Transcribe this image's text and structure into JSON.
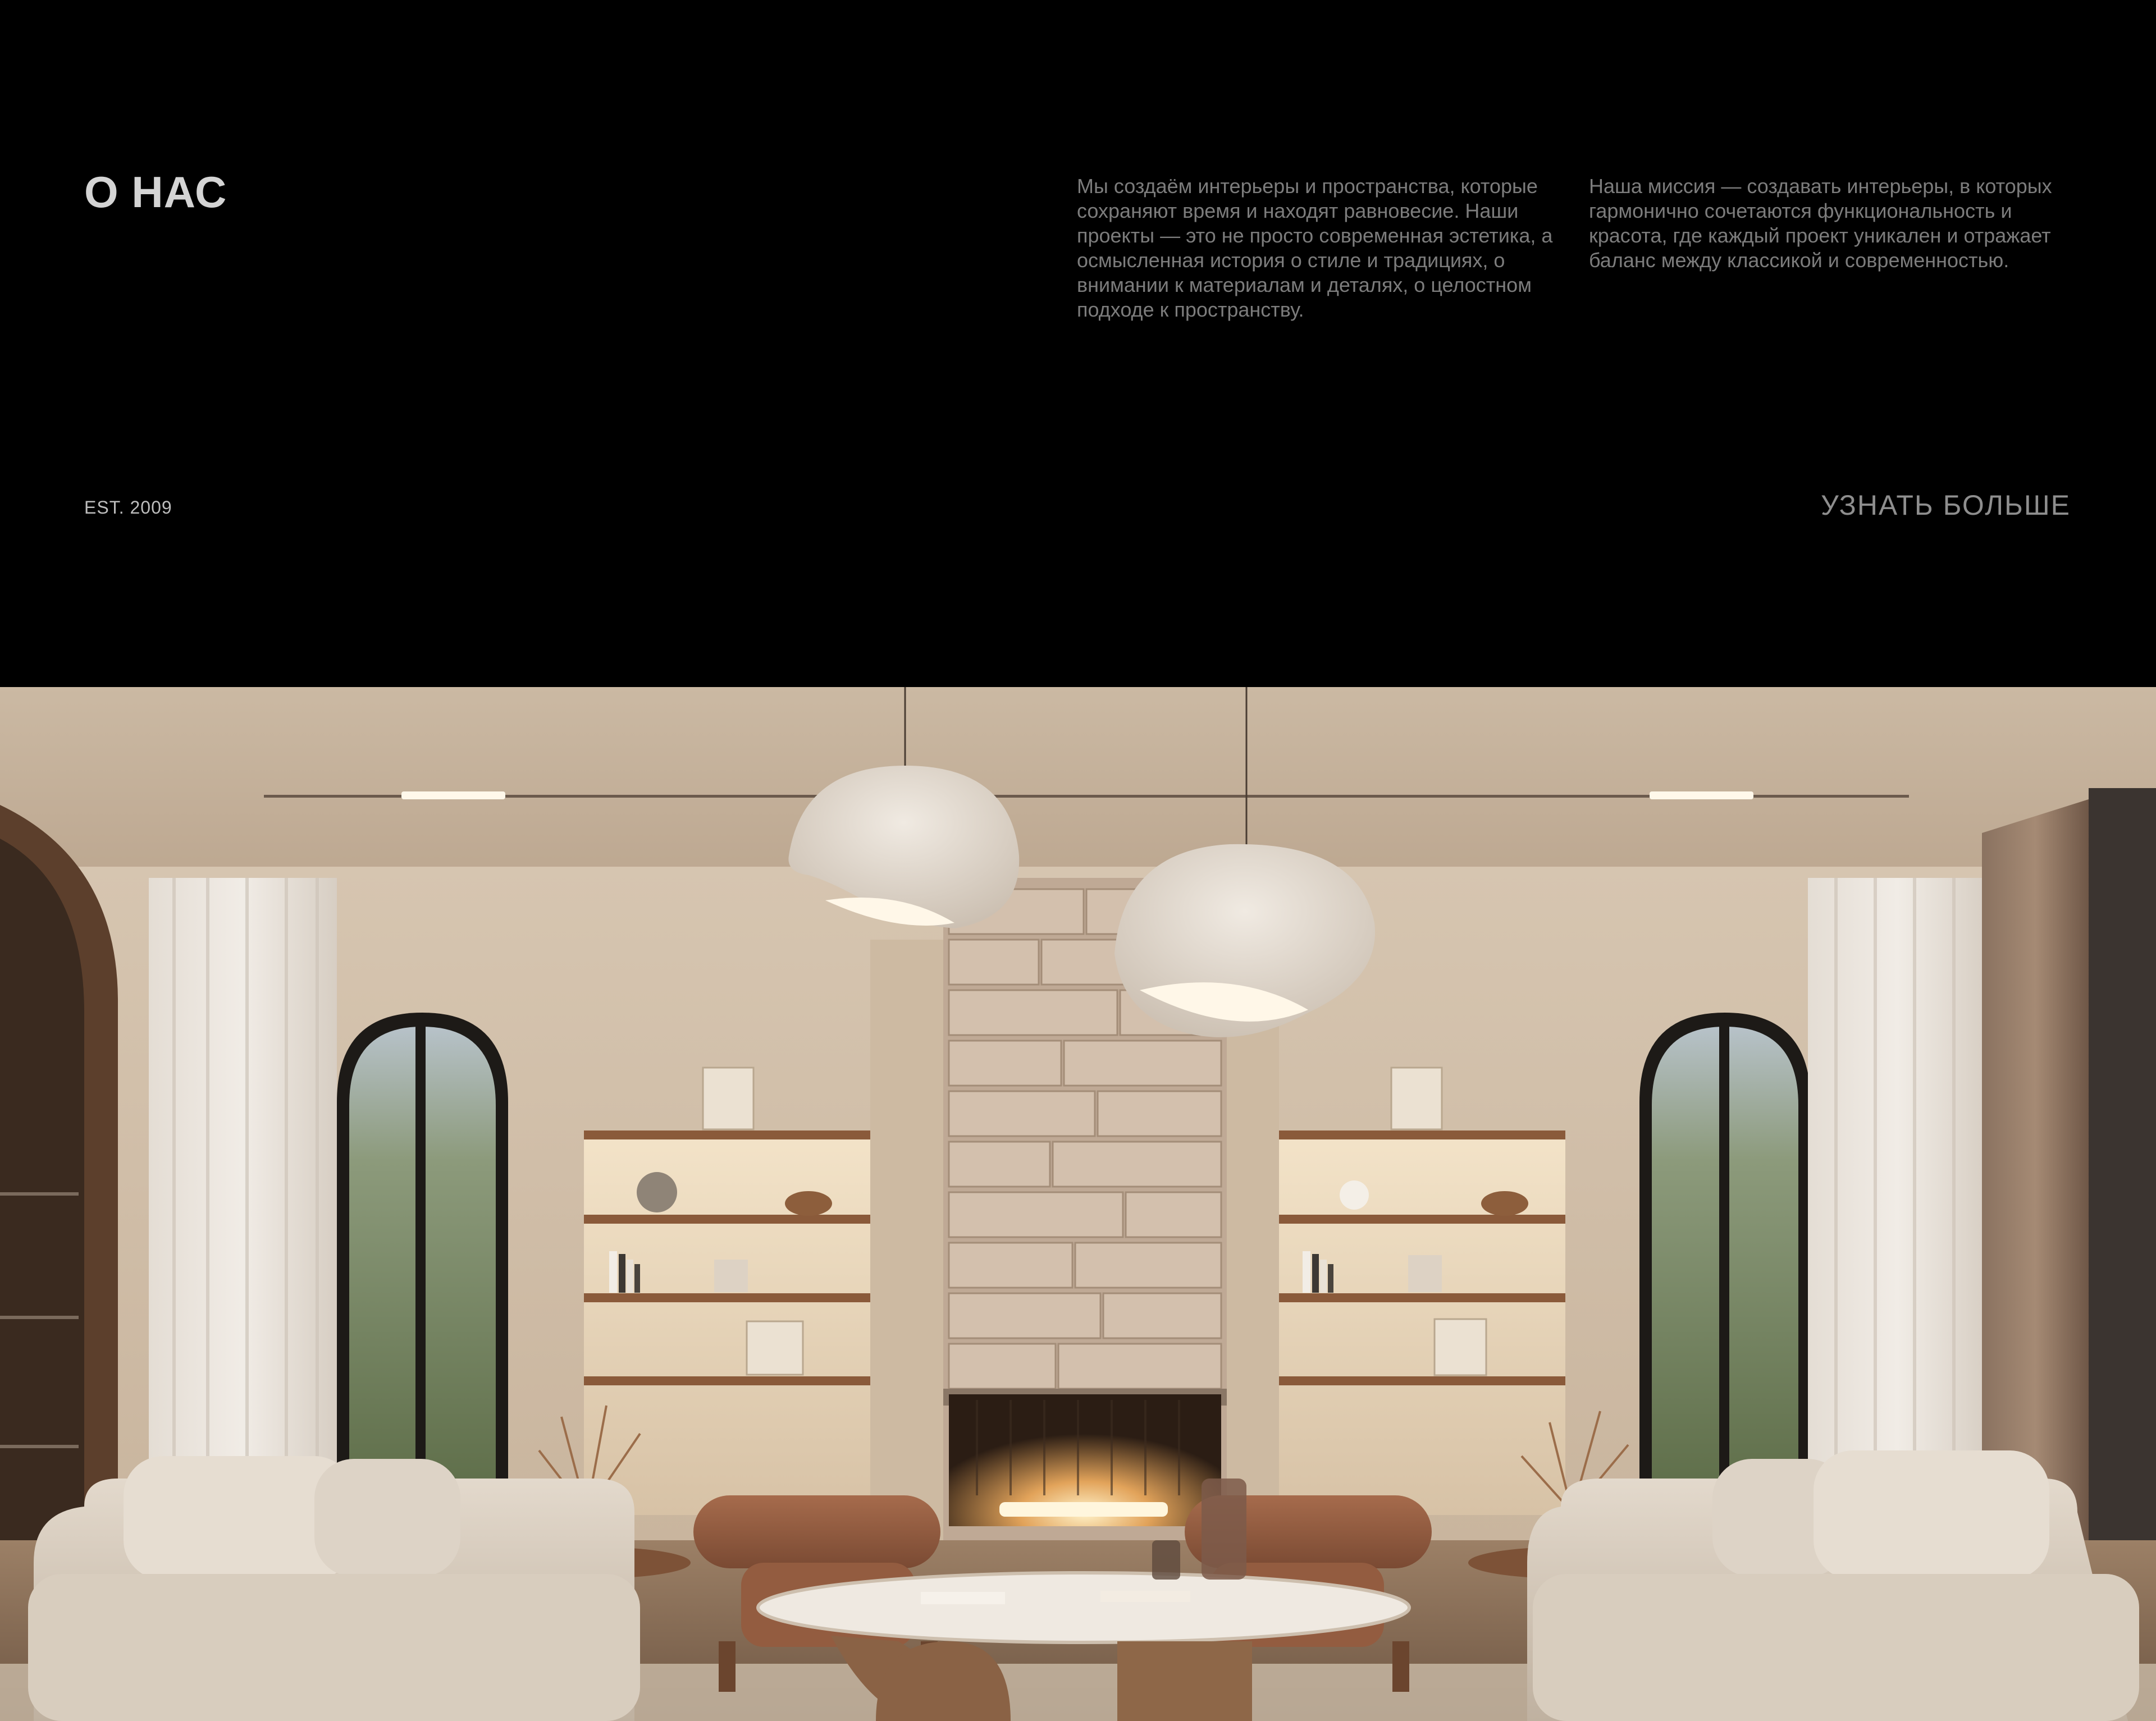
{
  "about": {
    "title": "О НАС",
    "paragraph_1": "Мы создаём интерьеры и пространства, которые сохраняют время и находят равновесие. Наши проекты — это не просто современная эстетика, а осмысленная история о стиле и традициях, о внимании к материалам и деталях, о целостном подходе к пространству.",
    "paragraph_2": "Наша миссия — создавать интерьеры, в которых гармонично сочетаются функциональность и красота, где каждый проект уникален и отражает баланс между классикой и современностью.",
    "established": "EST. 2009",
    "more_link": "УЗНАТЬ БОЛЬШЕ"
  },
  "hero": {
    "image_alt": "Интерьер гостиной: арочные окна, каменный камин, подвесные светильники, диваны и кресла"
  },
  "colors": {
    "background": "#000000",
    "title_text": "#d4d4d4",
    "body_text": "#7c7c7c",
    "link_text": "#8e8e8e",
    "wall": "#d8c8b4",
    "wood": "#8a5a3a"
  }
}
